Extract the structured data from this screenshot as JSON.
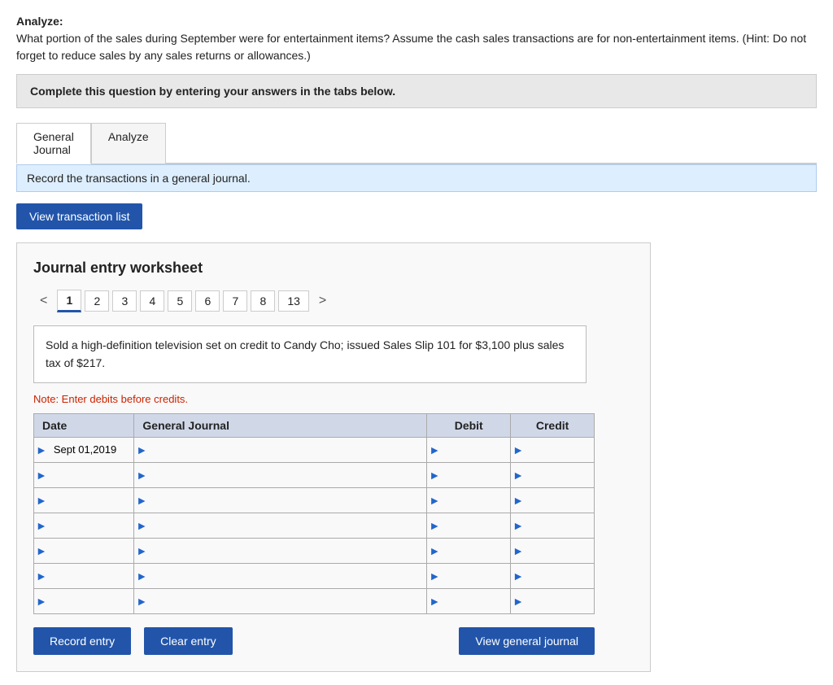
{
  "header": {
    "analyze_label": "Analyze:",
    "question_text": "What portion of the sales during September were for entertainment items? Assume the cash sales transactions are for non-entertainment items. (Hint: Do not forget to reduce sales by any sales returns or allowances.)"
  },
  "instruction_box": {
    "text": "Complete this question by entering your answers in the tabs below."
  },
  "tabs": [
    {
      "id": "general-journal",
      "label_line1": "General",
      "label_line2": "Journal",
      "active": true
    },
    {
      "id": "analyze",
      "label_line1": "Analyze",
      "label_line2": "",
      "active": false
    }
  ],
  "tab_note": "Record the transactions in a general journal.",
  "view_btn_label": "View transaction list",
  "worksheet": {
    "title": "Journal entry worksheet",
    "pages": [
      "1",
      "2",
      "3",
      "4",
      "5",
      "6",
      "7",
      "8",
      "13"
    ],
    "active_page": "1",
    "description": "Sold a high-definition television set on credit to Candy Cho; issued Sales Slip 101 for $3,100 plus sales tax of $217.",
    "note": "Note: Enter debits before credits.",
    "table": {
      "headers": [
        "Date",
        "General Journal",
        "Debit",
        "Credit"
      ],
      "rows": [
        {
          "date": "Sept 01,2019",
          "journal": "",
          "debit": "",
          "credit": ""
        },
        {
          "date": "",
          "journal": "",
          "debit": "",
          "credit": ""
        },
        {
          "date": "",
          "journal": "",
          "debit": "",
          "credit": ""
        },
        {
          "date": "",
          "journal": "",
          "debit": "",
          "credit": ""
        },
        {
          "date": "",
          "journal": "",
          "debit": "",
          "credit": ""
        },
        {
          "date": "",
          "journal": "",
          "debit": "",
          "credit": ""
        },
        {
          "date": "",
          "journal": "",
          "debit": "",
          "credit": ""
        }
      ]
    },
    "buttons": {
      "record_entry": "Record entry",
      "clear_entry": "Clear entry",
      "view_general_journal": "View general journal"
    }
  }
}
